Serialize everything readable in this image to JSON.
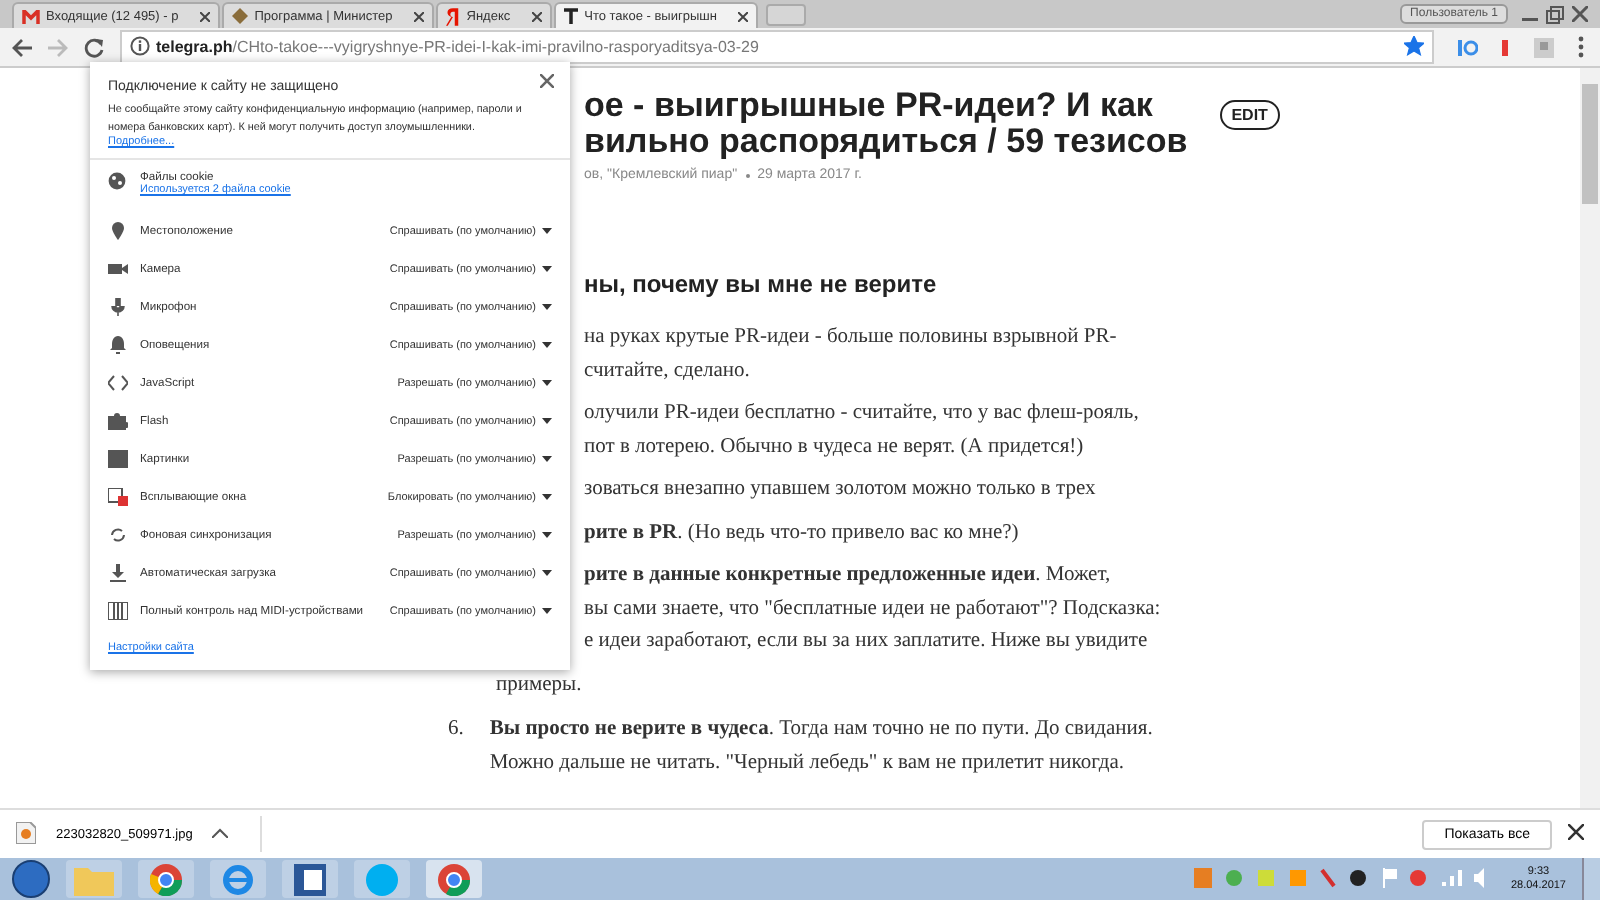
{
  "tabs": [
    {
      "title": "Входящие (12 495) - р",
      "selected": false
    },
    {
      "title": "Программа | Министер",
      "selected": false
    },
    {
      "title": "Яндекс",
      "selected": false
    },
    {
      "title": "Что такое - выигрышн",
      "selected": true
    }
  ],
  "profile": "Пользователь 1",
  "address": {
    "host": "telegra.ph",
    "path": "/CHto-takoe---vyigryshnye-PR-idei-I-kak-imi-pravilno-rasporyaditsya-03-29",
    "bookmarked": true
  },
  "popup": {
    "title": "Подключение к сайту не защищено",
    "warning": "Не сообщайте этому сайту конфиденциальную информацию (например, пароли и номера банковских карт). К ней могут получить доступ злоумышленники.",
    "more_link": "Подробнее...",
    "cookies": {
      "label": "Файлы cookie",
      "link": "Используется 2 файла cookie"
    },
    "permissions": [
      {
        "label": "Местоположение",
        "value": "Спрашивать (по умолчанию)"
      },
      {
        "label": "Камера",
        "value": "Спрашивать (по умолчанию)"
      },
      {
        "label": "Микрофон",
        "value": "Спрашивать (по умолчанию)"
      },
      {
        "label": "Оповещения",
        "value": "Спрашивать (по умолчанию)"
      },
      {
        "label": "JavaScript",
        "value": "Разрешать (по умолчанию)"
      },
      {
        "label": "Flash",
        "value": "Спрашивать (по умолчанию)"
      },
      {
        "label": "Картинки",
        "value": "Разрешать (по умолчанию)"
      },
      {
        "label": "Всплывающие окна",
        "value": "Блокировать (по умолчанию)"
      },
      {
        "label": "Фоновая синхронизация",
        "value": "Разрешать (по умолчанию)"
      },
      {
        "label": "Автоматическая загрузка",
        "value": "Спрашивать (по умолчанию)"
      },
      {
        "label": "Полный контроль над MIDI-устройствами",
        "value": "Спрашивать (по умолчанию)"
      }
    ],
    "settings_link": "Настройки сайта"
  },
  "article": {
    "title_lines": [
      "ое - выигрышные PR-идеи? И как",
      "вильно распорядиться / 59 тезисов"
    ],
    "edit_button": "EDIT",
    "author": "ов, \"Кремлевский пиар\"",
    "date": "29 марта 2017 г.",
    "heading": "ны, почему вы мне не верите",
    "paragraphs": [
      [
        "на руках крутые PR-идеи - больше половины взрывной PR-",
        "считайте, сделано."
      ],
      [
        "олучили PR-идеи бесплатно - считайте, что у вас флеш-рояль,",
        "пот в лотерею. Обычно в чудеса не верят. (А придется!)"
      ],
      [
        "зоваться внезапно упавшем золотом можно только в трех"
      ],
      [
        "**рите в PR**. (Но ведь что-то привело вас ко мне?)"
      ],
      [
        "**рите в данные конкретные предложенные идеи**. Может,",
        "вы сами знаете, что \"бесплатные идеи не работают\"? Подсказка:",
        "е идеи заработают, если вы за них заплатите. Ниже вы увидите"
      ]
    ],
    "continuation": "примеры.",
    "items": [
      {
        "number": "6.",
        "lines": [
          "**Вы просто не верите в чудеса**. Тогда нам точно не по пути. До свидания.",
          "Можно дальше не читать. \"Черный лебедь\" к вам не прилетит никогда."
        ]
      }
    ]
  },
  "download": {
    "file": "223032820_509971.jpg",
    "show_all": "Показать все"
  },
  "clock": {
    "time": "9:33",
    "date": "28.04.2017"
  }
}
